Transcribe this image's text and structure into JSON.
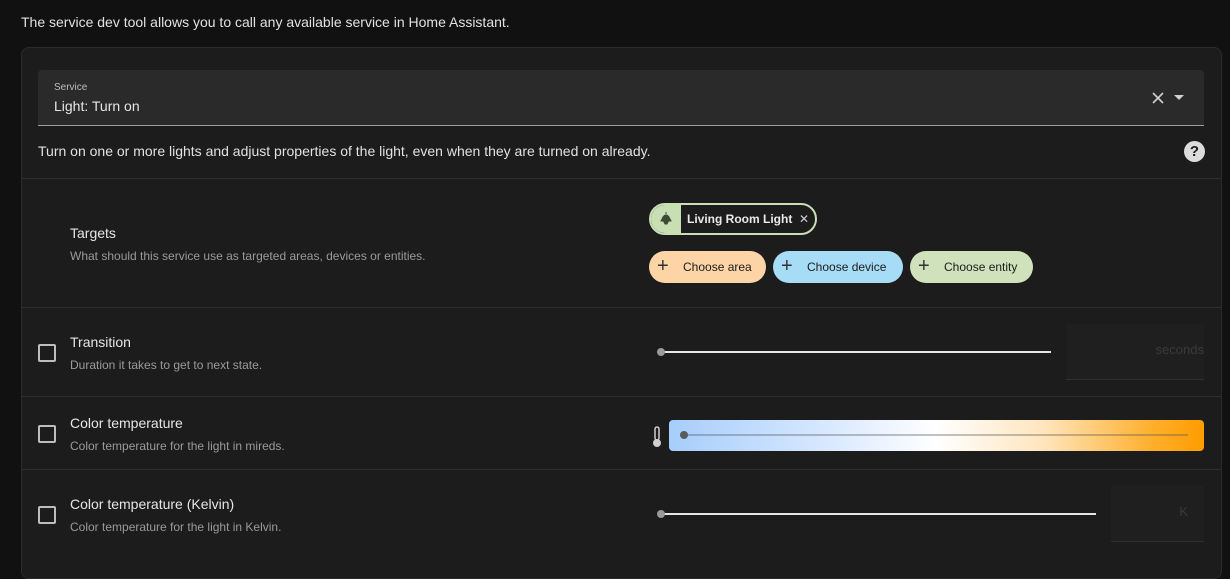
{
  "intro_text": "The service dev tool allows you to call any available service in Home Assistant.",
  "service_picker": {
    "label": "Service",
    "value": "Light: Turn on",
    "clear_icon": "close-icon",
    "dropdown_icon": "menu-down-icon"
  },
  "service_description": "Turn on one or more lights and adjust properties of the light, even when they are turned on already.",
  "help_icon": "help-circle-icon",
  "targets": {
    "title": "Targets",
    "description": "What should this service use as targeted areas, devices or entities.",
    "selected_entity": {
      "name": "Living Room Light",
      "icon": "lightbulb-icon",
      "remove_icon": "close-icon"
    },
    "add_chips": [
      {
        "label": "Choose area",
        "icon": "plus-icon",
        "color": "#fdd4a5"
      },
      {
        "label": "Choose device",
        "icon": "plus-icon",
        "color": "#a6dcf6"
      },
      {
        "label": "Choose entity",
        "icon": "plus-icon",
        "color": "#cfe2bc"
      }
    ]
  },
  "fields": [
    {
      "title": "Transition",
      "description": "Duration it takes to get to next state.",
      "unit": "seconds",
      "checked": false
    },
    {
      "title": "Color temperature",
      "description": "Color temperature for the light in mireds.",
      "checked": false
    },
    {
      "title": "Color temperature (Kelvin)",
      "description": "Color temperature for the light in Kelvin.",
      "unit": "K",
      "checked": false
    }
  ],
  "colors": {
    "background": "#111111",
    "card": "#1c1c1c",
    "accent_area": "#fdd4a5",
    "accent_device": "#a6dcf6",
    "accent_entity": "#cfe2bc"
  }
}
